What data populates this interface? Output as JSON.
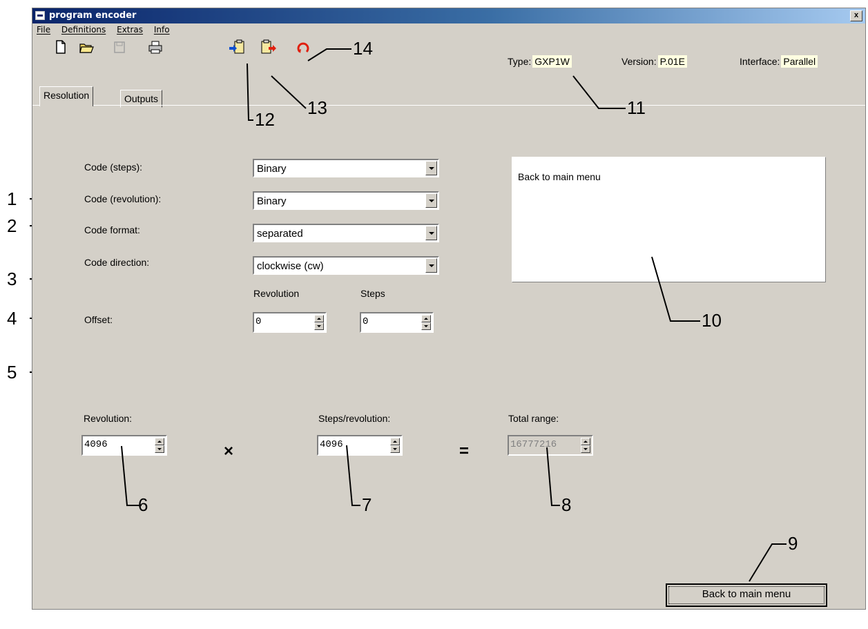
{
  "window": {
    "title": "program encoder",
    "close_label": "x"
  },
  "menu": [
    "File",
    "Definitions",
    "Extras",
    "Info"
  ],
  "toolbar": {
    "icons": [
      "new-file-icon",
      "open-folder-icon",
      "save-icon",
      "print-icon",
      "import-clipboard-icon",
      "export-clipboard-icon",
      "reset-icon"
    ]
  },
  "status": {
    "type_label": "Type:",
    "type_value": "GXP1W",
    "version_label": "Version:",
    "version_value": "P.01E",
    "interface_label": "Interface:",
    "interface_value": "Parallel"
  },
  "tabs": [
    "Resolution",
    "Outputs"
  ],
  "form": {
    "code_steps_label": "Code (steps):",
    "code_steps_value": "Binary",
    "code_rev_label": "Code (revolution):",
    "code_rev_value": "Binary",
    "code_format_label": "Code format:",
    "code_format_value": "separated",
    "code_dir_label": "Code direction:",
    "code_dir_value": "clockwise (cw)",
    "offset_label": "Offset:",
    "offset_rev_header": "Revolution",
    "offset_steps_header": "Steps",
    "offset_rev_value": "0",
    "offset_steps_value": "0"
  },
  "info_box": {
    "text": "Back to main menu"
  },
  "range": {
    "revolution_label": "Revolution:",
    "revolution_value": "4096",
    "steps_label": "Steps/revolution:",
    "steps_value": "4096",
    "total_label": "Total range:",
    "total_value": "16777216",
    "times": "×",
    "equals": "="
  },
  "back_button": {
    "label": "Back to main menu"
  },
  "callouts": [
    "1",
    "2",
    "3",
    "4",
    "5",
    "6",
    "7",
    "8",
    "9",
    "10",
    "11",
    "12",
    "13",
    "14"
  ],
  "colors": {
    "title_start": "#0a246a",
    "title_end": "#a6caf0",
    "face": "#d4d0c8",
    "status_bg": "#ffffe1"
  }
}
